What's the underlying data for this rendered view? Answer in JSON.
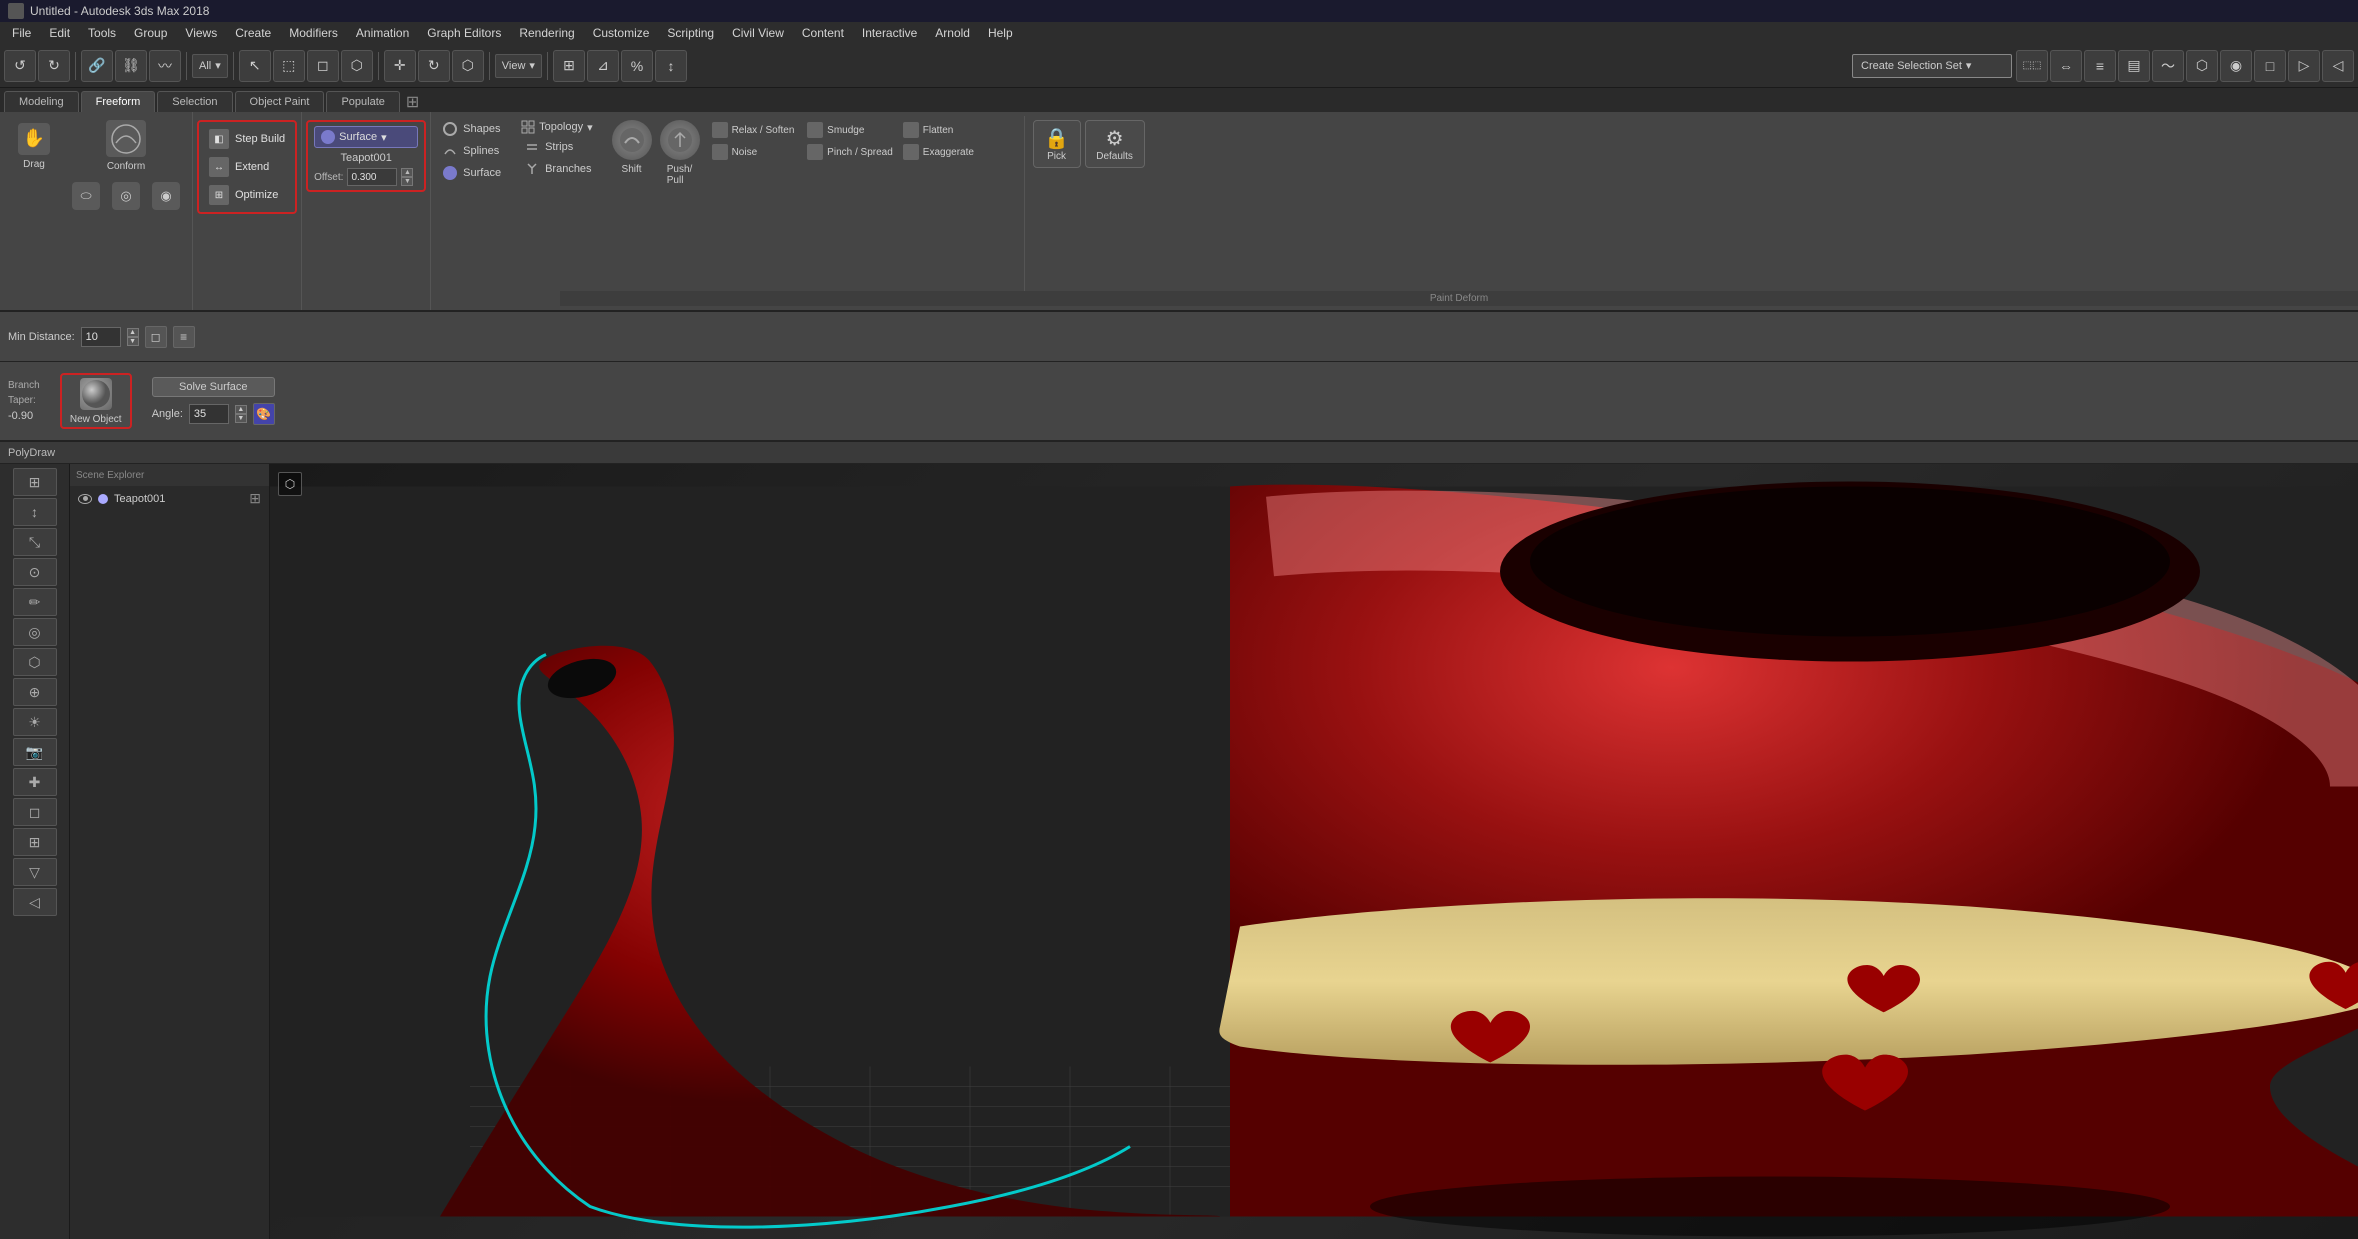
{
  "titlebar": {
    "title": "Untitled - Autodesk 3ds Max 2018",
    "icon": "app-icon"
  },
  "menubar": {
    "items": [
      "File",
      "Edit",
      "Tools",
      "Group",
      "Views",
      "Create",
      "Modifiers",
      "Animation",
      "Graph Editors",
      "Rendering",
      "Customize",
      "Scripting",
      "Civil View",
      "Content",
      "Interactive",
      "Arnold",
      "Help"
    ]
  },
  "main_toolbar": {
    "dropdown_label": "All",
    "create_selection_set": "Create Selection Set",
    "view_dropdown": "View"
  },
  "ribbon": {
    "tabs": [
      "Modeling",
      "Freeform",
      "Selection",
      "Object Paint",
      "Populate"
    ],
    "active_tab": "Freeform",
    "step_build_group": {
      "step_build": "Step Build",
      "extend": "Extend",
      "optimize": "Optimize"
    },
    "surface_group": {
      "surface_label": "Surface",
      "object_name": "Teapot001",
      "offset_label": "Offset:",
      "offset_value": "0.300"
    },
    "shapes_section": {
      "shapes": "Shapes",
      "splines": "Splines",
      "surface": "Surface"
    },
    "topology_section": {
      "topology": "Topology",
      "strips": "Strips",
      "branches": "Branches"
    },
    "paint_deform": {
      "label": "Paint Deform",
      "shift": "Shift",
      "push_pull": "Push/\nPull",
      "relax_soften": "Relax / Soften",
      "smudge": "Smudge",
      "flatten": "Flatten",
      "noise": "Noise",
      "pinch_spread": "Pinch / Spread",
      "exaggerate": "Exaggerate"
    },
    "pick_section": {
      "pick": "Pick",
      "defaults": "Defaults"
    }
  },
  "lower_controls": {
    "min_distance_label": "Min Distance:",
    "min_distance_value": "10"
  },
  "branch_section": {
    "branch_label": "Branch",
    "taper_label": "Taper:",
    "taper_value": "-0.90",
    "new_object_label": "New Object",
    "solve_surface": "Solve Surface",
    "angle_label": "Angle:",
    "angle_value": "35"
  },
  "polydraw_bar": {
    "label": "PolyDraw"
  },
  "scene_explorer": {
    "items": [
      {
        "name": "Teapot001",
        "visible": true
      }
    ]
  },
  "viewport": {
    "bg_color_start": "#1a1a1a",
    "bg_color_end": "#2a2a2a"
  }
}
